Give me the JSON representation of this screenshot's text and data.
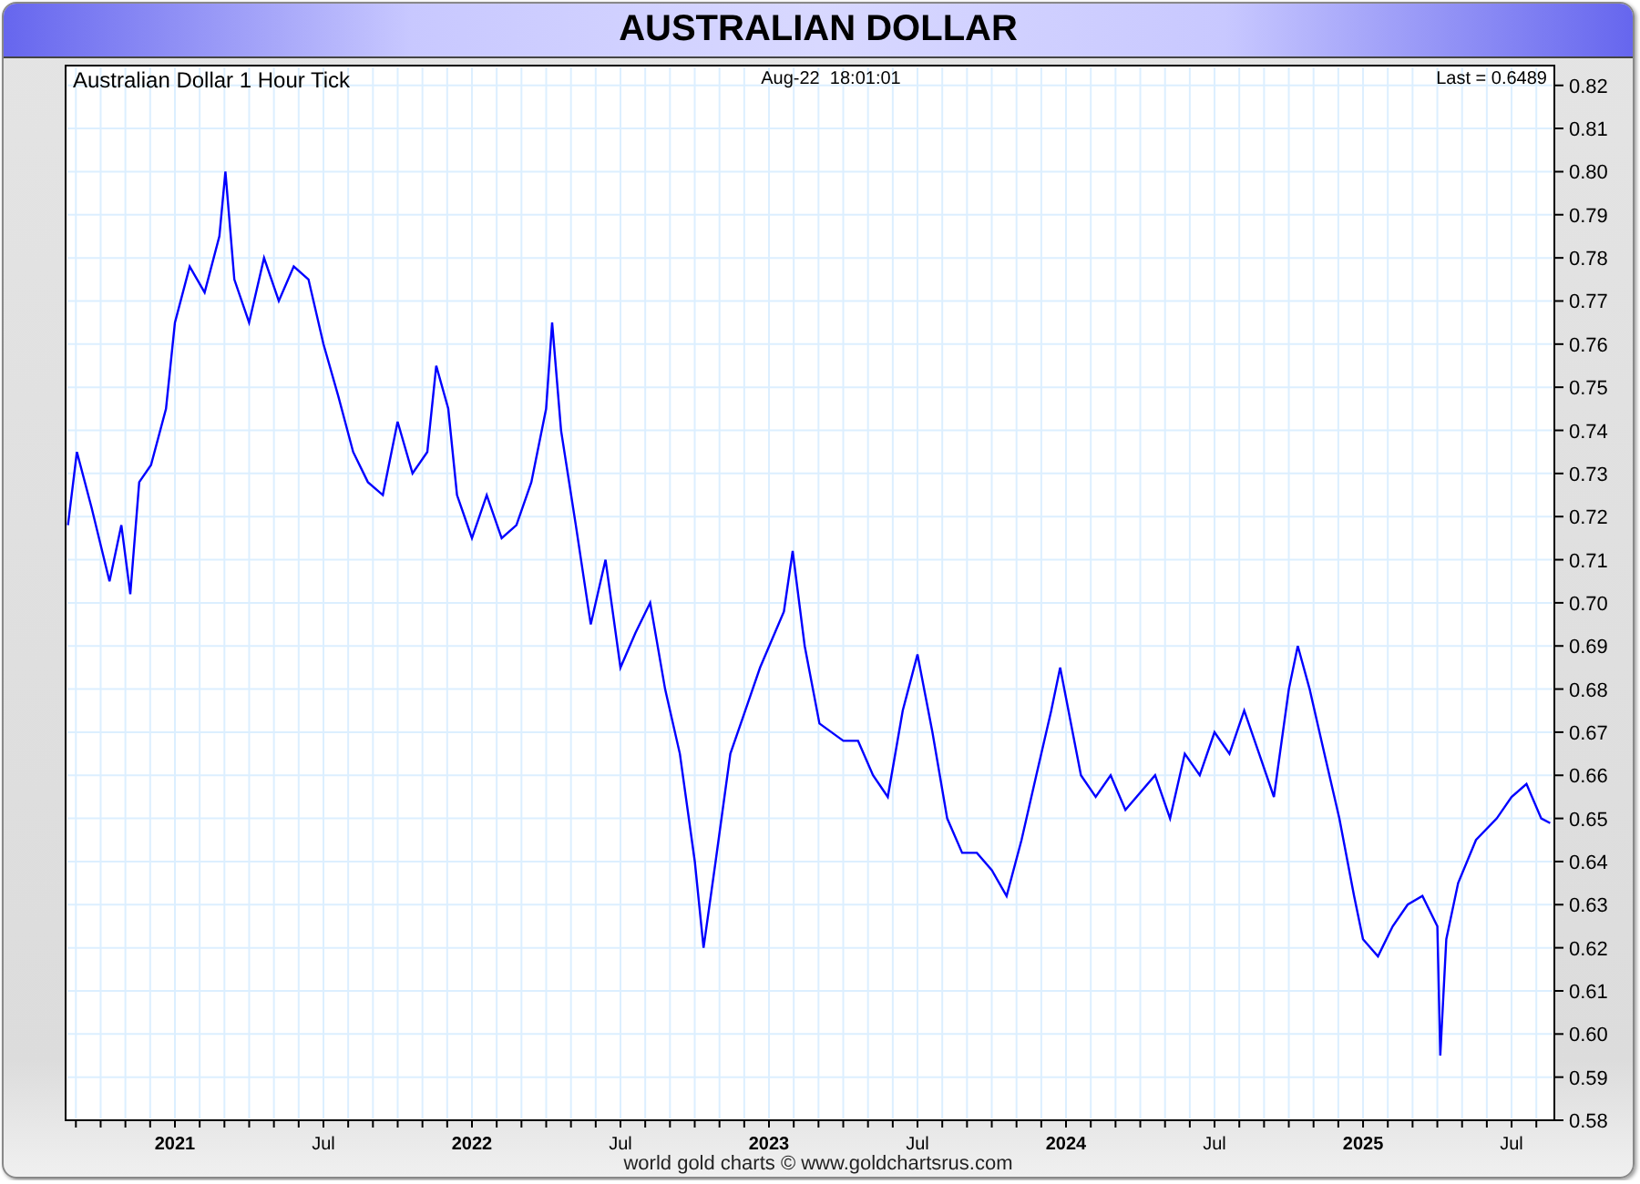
{
  "header": {
    "title": "AUSTRALIAN DOLLAR"
  },
  "chart": {
    "title": "Australian Dollar 1 Hour Tick",
    "timestamp": "Aug-22  18:01:01",
    "last": "Last = 0.6489",
    "chart_data": {
      "type": "line",
      "grid": true,
      "xlim": [
        2020.632,
        2025.644
      ],
      "ylim": [
        0.58,
        0.8246
      ],
      "x": [
        2020.64,
        2020.67,
        2020.72,
        2020.78,
        2020.82,
        2020.85,
        2020.88,
        2020.92,
        2020.97,
        2021.0,
        2021.05,
        2021.1,
        2021.15,
        2021.17,
        2021.2,
        2021.25,
        2021.3,
        2021.35,
        2021.4,
        2021.45,
        2021.5,
        2021.55,
        2021.6,
        2021.65,
        2021.7,
        2021.75,
        2021.8,
        2021.85,
        2021.88,
        2021.92,
        2021.95,
        2022.0,
        2022.05,
        2022.1,
        2022.15,
        2022.2,
        2022.25,
        2022.27,
        2022.3,
        2022.35,
        2022.4,
        2022.45,
        2022.5,
        2022.55,
        2022.6,
        2022.65,
        2022.7,
        2022.75,
        2022.78,
        2022.82,
        2022.87,
        2022.92,
        2022.97,
        2023.05,
        2023.08,
        2023.12,
        2023.17,
        2023.25,
        2023.3,
        2023.35,
        2023.4,
        2023.45,
        2023.5,
        2023.55,
        2023.6,
        2023.65,
        2023.7,
        2023.75,
        2023.8,
        2023.85,
        2023.9,
        2023.95,
        2023.98,
        2024.05,
        2024.1,
        2024.15,
        2024.2,
        2024.3,
        2024.35,
        2024.4,
        2024.45,
        2024.5,
        2024.55,
        2024.6,
        2024.65,
        2024.7,
        2024.75,
        2024.78,
        2024.82,
        2024.87,
        2024.92,
        2024.97,
        2025.0,
        2025.05,
        2025.1,
        2025.15,
        2025.2,
        2025.25,
        2025.26,
        2025.28,
        2025.32,
        2025.38,
        2025.45,
        2025.5,
        2025.55,
        2025.6,
        2025.63
      ],
      "series": [
        {
          "color": "#0000ff",
          "values": [
            0.718,
            0.735,
            0.722,
            0.705,
            0.718,
            0.702,
            0.728,
            0.732,
            0.745,
            0.765,
            0.778,
            0.772,
            0.785,
            0.8,
            0.775,
            0.765,
            0.78,
            0.77,
            0.778,
            0.775,
            0.76,
            0.748,
            0.735,
            0.728,
            0.725,
            0.742,
            0.73,
            0.735,
            0.755,
            0.745,
            0.725,
            0.715,
            0.725,
            0.715,
            0.718,
            0.728,
            0.745,
            0.765,
            0.74,
            0.718,
            0.695,
            0.71,
            0.685,
            0.693,
            0.7,
            0.68,
            0.665,
            0.64,
            0.62,
            0.64,
            0.665,
            0.675,
            0.685,
            0.698,
            0.712,
            0.69,
            0.672,
            0.668,
            0.668,
            0.66,
            0.655,
            0.675,
            0.688,
            0.67,
            0.65,
            0.642,
            0.642,
            0.638,
            0.632,
            0.645,
            0.66,
            0.675,
            0.685,
            0.66,
            0.655,
            0.66,
            0.652,
            0.66,
            0.65,
            0.665,
            0.66,
            0.67,
            0.665,
            0.675,
            0.665,
            0.655,
            0.68,
            0.69,
            0.68,
            0.665,
            0.65,
            0.632,
            0.622,
            0.618,
            0.625,
            0.63,
            0.632,
            0.625,
            0.595,
            0.622,
            0.635,
            0.645,
            0.65,
            0.655,
            0.658,
            0.65,
            0.6489
          ]
        }
      ],
      "xticks": [
        {
          "value": 2021,
          "label": "2021"
        },
        {
          "value": 2021.5,
          "label": "Jul"
        },
        {
          "value": 2022,
          "label": "2022"
        },
        {
          "value": 2022.5,
          "label": "Jul"
        },
        {
          "value": 2023,
          "label": "2023"
        },
        {
          "value": 2023.5,
          "label": "Jul"
        },
        {
          "value": 2024,
          "label": "2024"
        },
        {
          "value": 2024.5,
          "label": "Jul"
        },
        {
          "value": 2025,
          "label": "2025"
        },
        {
          "value": 2025.5,
          "label": "Jul"
        }
      ],
      "yticks": [
        {
          "value": 0.58,
          "label": "0.58"
        },
        {
          "value": 0.59,
          "label": "0.59"
        },
        {
          "value": 0.6,
          "label": "0.60"
        },
        {
          "value": 0.61,
          "label": "0.61"
        },
        {
          "value": 0.62,
          "label": "0.62"
        },
        {
          "value": 0.63,
          "label": "0.63"
        },
        {
          "value": 0.64,
          "label": "0.64"
        },
        {
          "value": 0.65,
          "label": "0.65"
        },
        {
          "value": 0.66,
          "label": "0.66"
        },
        {
          "value": 0.67,
          "label": "0.67"
        },
        {
          "value": 0.68,
          "label": "0.68"
        },
        {
          "value": 0.69,
          "label": "0.69"
        },
        {
          "value": 0.7,
          "label": "0.70"
        },
        {
          "value": 0.71,
          "label": "0.71"
        },
        {
          "value": 0.72,
          "label": "0.72"
        },
        {
          "value": 0.73,
          "label": "0.73"
        },
        {
          "value": 0.74,
          "label": "0.74"
        },
        {
          "value": 0.75,
          "label": "0.75"
        },
        {
          "value": 0.76,
          "label": "0.76"
        },
        {
          "value": 0.77,
          "label": "0.77"
        },
        {
          "value": 0.78,
          "label": "0.78"
        },
        {
          "value": 0.79,
          "label": "0.79"
        },
        {
          "value": 0.8,
          "label": "0.80"
        },
        {
          "value": 0.81,
          "label": "0.81"
        },
        {
          "value": 0.82,
          "label": "0.82"
        }
      ]
    }
  },
  "footer": "world gold charts © www.goldchartsrus.com"
}
